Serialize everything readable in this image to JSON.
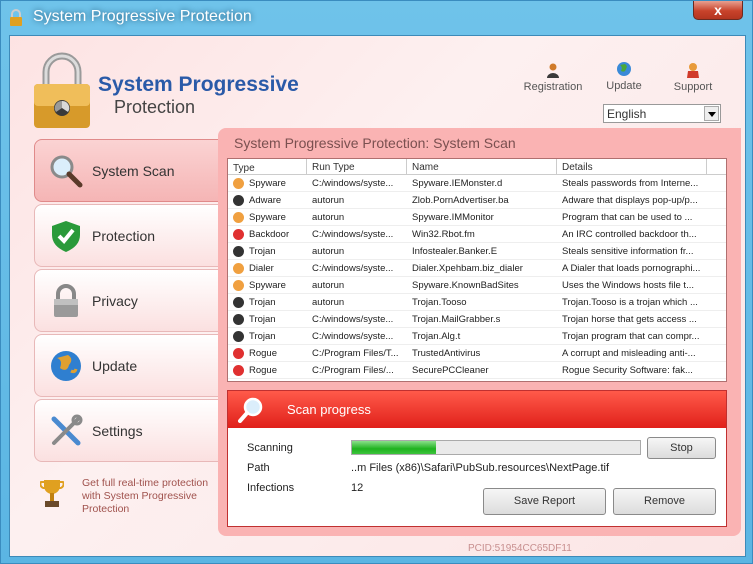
{
  "window": {
    "title": "System Progressive Protection",
    "close_label": "x"
  },
  "brand": {
    "line1": "System Progressive",
    "line2": "Protection"
  },
  "toplinks": [
    {
      "label": "Registration",
      "icon": "person-icon"
    },
    {
      "label": "Update",
      "icon": "globe-icon"
    },
    {
      "label": "Support",
      "icon": "support-icon"
    }
  ],
  "language": {
    "selected": "English"
  },
  "nav": [
    {
      "label": "System Scan",
      "icon": "magnifier-icon",
      "active": true
    },
    {
      "label": "Protection",
      "icon": "shield-check-icon",
      "active": false
    },
    {
      "label": "Privacy",
      "icon": "padlock-icon",
      "active": false
    },
    {
      "label": "Update",
      "icon": "globe-icon",
      "active": false
    },
    {
      "label": "Settings",
      "icon": "tools-icon",
      "active": false
    }
  ],
  "promo": {
    "text": "Get full real-time protection with System Progressive Protection"
  },
  "panel": {
    "title": "System Progressive Protection: System Scan"
  },
  "table": {
    "columns": [
      "Type",
      "Run Type",
      "Name",
      "Details"
    ],
    "rows": [
      {
        "severity": "#f0a040",
        "type": "Spyware",
        "run": "C:/windows/syste...",
        "name": "Spyware.IEMonster.d",
        "details": "Steals passwords from Interne..."
      },
      {
        "severity": "#333333",
        "type": "Adware",
        "run": "autorun",
        "name": "Zlob.PornAdvertiser.ba",
        "details": "Adware that displays pop-up/p..."
      },
      {
        "severity": "#f0a040",
        "type": "Spyware",
        "run": "autorun",
        "name": "Spyware.IMMonitor",
        "details": "Program that can be used to ..."
      },
      {
        "severity": "#e03030",
        "type": "Backdoor",
        "run": "C:/windows/syste...",
        "name": "Win32.Rbot.fm",
        "details": "An IRC controlled backdoor th..."
      },
      {
        "severity": "#333333",
        "type": "Trojan",
        "run": "autorun",
        "name": "Infostealer.Banker.E",
        "details": "Steals sensitive information fr..."
      },
      {
        "severity": "#f0a040",
        "type": "Dialer",
        "run": "C:/windows/syste...",
        "name": "Dialer.Xpehbam.biz_dialer",
        "details": "A Dialer that loads pornographi..."
      },
      {
        "severity": "#f0a040",
        "type": "Spyware",
        "run": "autorun",
        "name": "Spyware.KnownBadSites",
        "details": "Uses the Windows hosts file t..."
      },
      {
        "severity": "#333333",
        "type": "Trojan",
        "run": "autorun",
        "name": "Trojan.Tooso",
        "details": "Trojan.Tooso is a trojan which ..."
      },
      {
        "severity": "#333333",
        "type": "Trojan",
        "run": "C:/windows/syste...",
        "name": "Trojan.MailGrabber.s",
        "details": "Trojan horse that gets access ..."
      },
      {
        "severity": "#333333",
        "type": "Trojan",
        "run": "C:/windows/syste...",
        "name": "Trojan.Alg.t",
        "details": "Trojan program that can compr..."
      },
      {
        "severity": "#e03030",
        "type": "Rogue",
        "run": "C:/Program Files/T...",
        "name": "TrustedAntivirus",
        "details": "A corrupt and misleading anti-..."
      },
      {
        "severity": "#e03030",
        "type": "Rogue",
        "run": "C:/Program Files/...",
        "name": "SecurePCCleaner",
        "details": "Rogue Security Software: fak..."
      }
    ]
  },
  "scan": {
    "header": "Scan progress",
    "scanning_label": "Scanning",
    "progress": 0.29,
    "path_label": "Path",
    "path_value": "..m Files (x86)\\Safari\\PubSub.resources\\NextPage.tif",
    "infections_label": "Infections",
    "infections_value": "12",
    "stop_label": "Stop",
    "save_label": "Save Report",
    "remove_label": "Remove"
  },
  "footer": {
    "pcid": "PCID:51954CC65DF11"
  }
}
